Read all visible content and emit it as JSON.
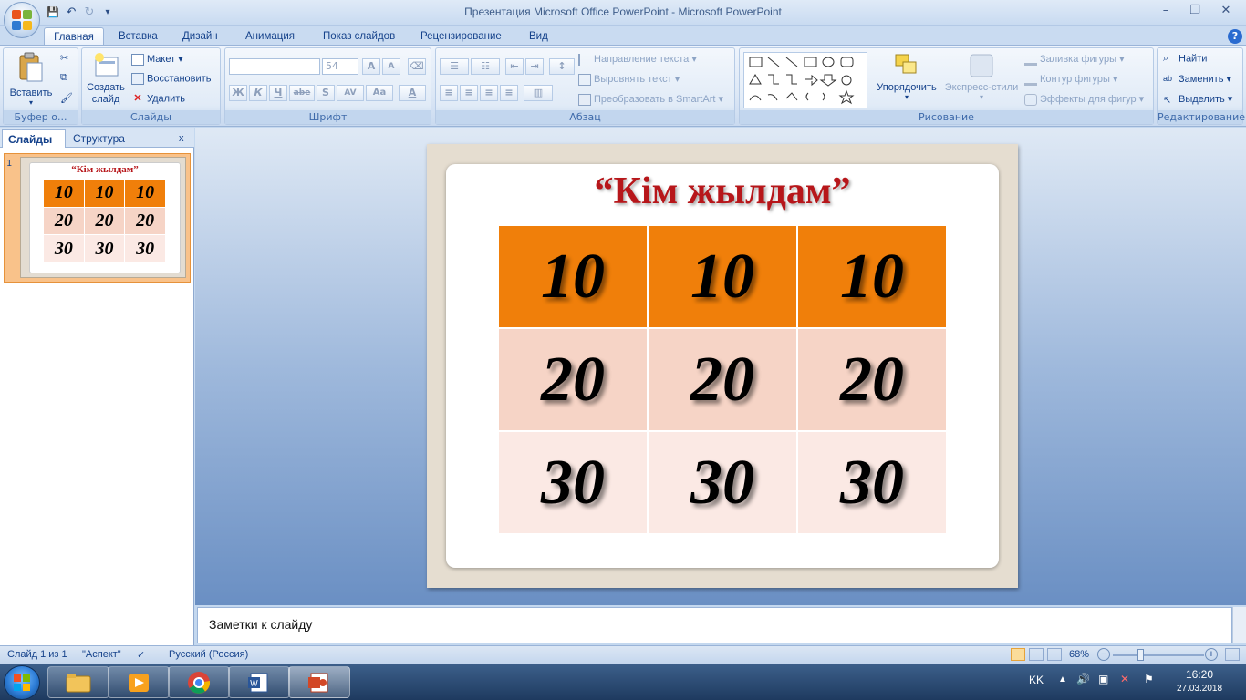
{
  "window": {
    "title": "Презентация Microsoft Office PowerPoint - Microsoft PowerPoint",
    "controls": {
      "minimize": "–",
      "maximize": "❐",
      "close": "✕"
    }
  },
  "qat": {
    "save": "💾",
    "undo": "↶",
    "redo": "↻",
    "customize": "▾"
  },
  "tabs": [
    "Главная",
    "Вставка",
    "Дизайн",
    "Анимация",
    "Показ слайдов",
    "Рецензирование",
    "Вид"
  ],
  "help_icon": "?",
  "ribbon": {
    "clipboard": {
      "label": "Буфер о...",
      "paste": "Вставить"
    },
    "slides": {
      "label": "Слайды",
      "new_slide": "Создать слайд",
      "layout": "Макет",
      "reset": "Восстановить",
      "delete": "Удалить"
    },
    "font": {
      "label": "Шрифт",
      "font_name": "",
      "font_size": "54",
      "bold": "Ж",
      "italic": "К",
      "underline": "Ч",
      "strike": "abe",
      "shadow": "S",
      "spacing": "AV",
      "case": "Aa",
      "color": "A",
      "grow": "A",
      "shrink": "A"
    },
    "paragraph": {
      "label": "Абзац",
      "text_direction": "Направление текста",
      "align_text": "Выровнять текст",
      "smartart": "Преобразовать в SmartArt"
    },
    "drawing": {
      "label": "Рисование",
      "arrange": "Упорядочить",
      "quick_styles": "Экспресс-стили",
      "shape_fill": "Заливка фигуры",
      "shape_outline": "Контур фигуры",
      "shape_effects": "Эффекты для фигур"
    },
    "editing": {
      "label": "Редактирование",
      "find": "Найти",
      "replace": "Заменить",
      "select": "Выделить"
    }
  },
  "left_pane": {
    "tabs": [
      "Слайды",
      "Структура"
    ],
    "close": "x",
    "slide_number": "1"
  },
  "slide": {
    "title": "“Кім жылдам”",
    "rows": [
      [
        "10",
        "10",
        "10"
      ],
      [
        "20",
        "20",
        "20"
      ],
      [
        "30",
        "30",
        "30"
      ]
    ],
    "row_colors": [
      "#f07f0a",
      "#f6d4c6",
      "#fbe9e4"
    ]
  },
  "notes": {
    "text": "Заметки к слайду"
  },
  "status": {
    "slide_info": "Слайд 1 из 1",
    "theme": "\"Аспект\"",
    "language": "Русский (Россия)",
    "zoom": "68%",
    "zoom_minus": "−",
    "zoom_plus": "+"
  },
  "taskbar": {
    "lang": "KK",
    "time": "16:20",
    "date": "27.03.2018"
  }
}
